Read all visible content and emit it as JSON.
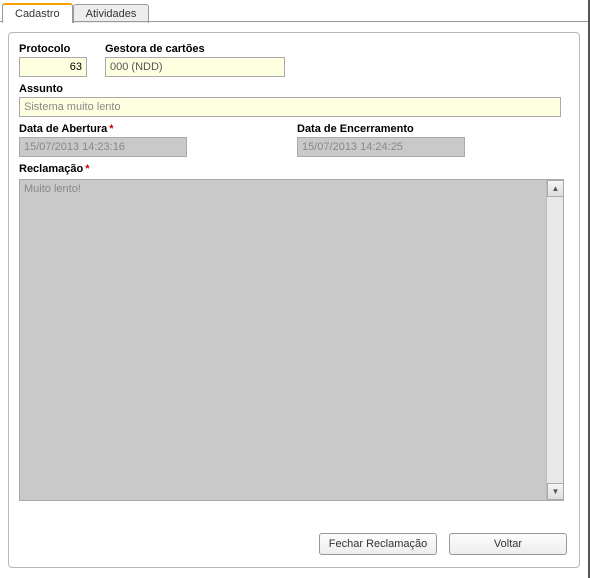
{
  "tabs": {
    "cadastro": "Cadastro",
    "atividades": "Atividades"
  },
  "labels": {
    "protocolo": "Protocolo",
    "gestora": "Gestora de cartões",
    "assunto": "Assunto",
    "data_abertura": "Data de Abertura",
    "data_encerramento": "Data de Encerramento",
    "reclamacao": "Reclamação"
  },
  "values": {
    "protocolo": "63",
    "gestora": "000 (NDD)",
    "assunto": "Sistema muito lento",
    "data_abertura": "15/07/2013 14:23:16",
    "data_encerramento": "15/07/2013 14:24:25",
    "reclamacao": "Muito lento!"
  },
  "buttons": {
    "fechar": "Fechar Reclamação",
    "voltar": "Voltar"
  }
}
